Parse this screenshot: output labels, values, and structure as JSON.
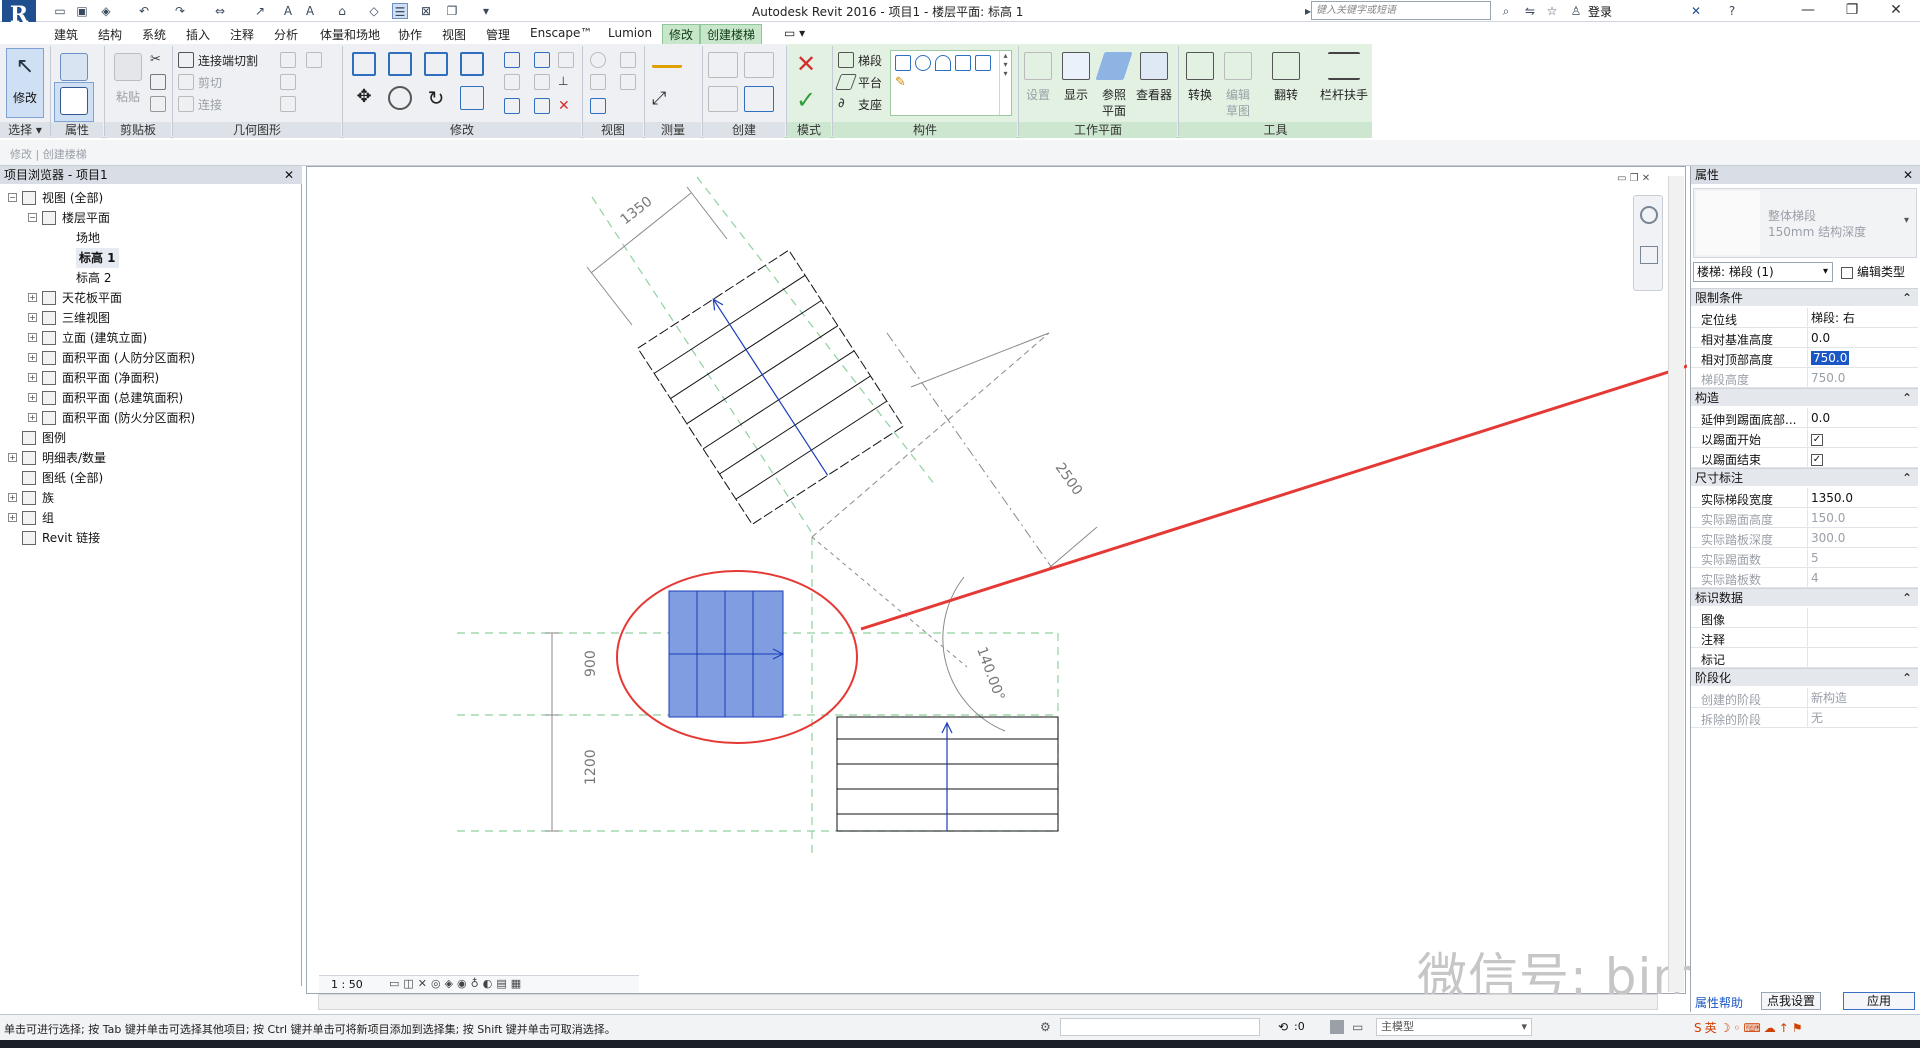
{
  "window": {
    "title": "Autodesk Revit 2016 -     项目1 - 楼层平面: 标高 1",
    "search_placeholder": "键入关键字或短语",
    "login": "登录",
    "minimize": "—",
    "restore": "❐",
    "close": "✕"
  },
  "ribbon_tabs": [
    "建筑",
    "结构",
    "系统",
    "插入",
    "注释",
    "分析",
    "体量和场地",
    "协作",
    "视图",
    "管理",
    "Enscape™",
    "Lumion",
    "修改",
    "创建楼梯"
  ],
  "ribbon": {
    "select_panel": {
      "label": "修改",
      "title": "选择 ▾"
    },
    "properties_panel": {
      "title": "属性"
    },
    "clipboard_panel": {
      "title": "剪贴板",
      "paste": "粘贴"
    },
    "geometry_panel": {
      "title": "几何图形",
      "join_cut": "连接端切割",
      "cut": "剪切",
      "join": "连接"
    },
    "modify_panel": {
      "title": "修改"
    },
    "view_panel": {
      "title": "视图"
    },
    "measure_panel": {
      "title": "测量"
    },
    "create_panel": {
      "title": "创建"
    },
    "mode_panel": {
      "title": "模式"
    },
    "components_panel": {
      "title": "构件",
      "run": "梯段",
      "landing": "平台",
      "support": "支座"
    },
    "workplane_panel": {
      "title": "工作平面",
      "set": "设置",
      "show": "显示",
      "ref_plane": "参照",
      "ref_plane2": "平面",
      "viewer": "查看器"
    },
    "tools_panel": {
      "title": "工具",
      "convert": "转换",
      "edit_sketch": "编辑",
      "edit_sketch2": "草图",
      "flip": "翻转",
      "railing": "栏杆扶手"
    }
  },
  "options_bar": {
    "text": "修改 | 创建楼梯"
  },
  "browser": {
    "title": "项目浏览器 - 项目1",
    "close": "✕",
    "items": [
      {
        "label": "视图 (全部)",
        "level": 0,
        "toggle": "−"
      },
      {
        "label": "楼层平面",
        "level": 1,
        "toggle": "−"
      },
      {
        "label": "场地",
        "level": 2,
        "toggle": ""
      },
      {
        "label": "标高 1",
        "level": 2,
        "toggle": "",
        "bold": true
      },
      {
        "label": "标高 2",
        "level": 2,
        "toggle": ""
      },
      {
        "label": "天花板平面",
        "level": 1,
        "toggle": "+"
      },
      {
        "label": "三维视图",
        "level": 1,
        "toggle": "+"
      },
      {
        "label": "立面 (建筑立面)",
        "level": 1,
        "toggle": "+"
      },
      {
        "label": "面积平面 (人防分区面积)",
        "level": 1,
        "toggle": "+"
      },
      {
        "label": "面积平面 (净面积)",
        "level": 1,
        "toggle": "+"
      },
      {
        "label": "面积平面 (总建筑面积)",
        "level": 1,
        "toggle": "+"
      },
      {
        "label": "面积平面 (防火分区面积)",
        "level": 1,
        "toggle": "+"
      },
      {
        "label": "图例",
        "level": 0,
        "toggle": ""
      },
      {
        "label": "明细表/数量",
        "level": 0,
        "toggle": "+"
      },
      {
        "label": "图纸 (全部)",
        "level": 0,
        "toggle": ""
      },
      {
        "label": "族",
        "level": 0,
        "toggle": "+"
      },
      {
        "label": "组",
        "level": 0,
        "toggle": "+"
      },
      {
        "label": "Revit 链接",
        "level": 0,
        "toggle": ""
      }
    ]
  },
  "canvas": {
    "dim_top": "1350",
    "dim_diag": "2500",
    "dim_angle": "140.00°",
    "dim_left1": "900",
    "dim_left2": "1200",
    "scale": "1 : 50",
    "watermark": "微信号: bimtech",
    "colors": {
      "selection": "#7f9de0",
      "highlight": "#e53935",
      "guide": "#8fd19e"
    }
  },
  "properties": {
    "title": "属性",
    "close": "✕",
    "type_name": "整体梯段",
    "type_desc": "150mm 结构深度",
    "selector": "楼梯: 梯段 (1)",
    "edit_type": "编辑类型",
    "sections": [
      {
        "title": "限制条件",
        "rows": [
          {
            "name": "定位线",
            "value": "梯段: 右"
          },
          {
            "name": "相对基准高度",
            "value": "0.0"
          },
          {
            "name": "相对顶部高度",
            "value": "750.0",
            "selected": true
          },
          {
            "name": "梯段高度",
            "value": "750.0",
            "dim": true
          }
        ]
      },
      {
        "title": "构造",
        "rows": [
          {
            "name": "延伸到踢面底部...",
            "value": "0.0"
          },
          {
            "name": "以踢面开始",
            "value": "✓",
            "check": true
          },
          {
            "name": "以踢面结束",
            "value": "✓",
            "check": true
          }
        ]
      },
      {
        "title": "尺寸标注",
        "rows": [
          {
            "name": "实际梯段宽度",
            "value": "1350.0"
          },
          {
            "name": "实际踢面高度",
            "value": "150.0",
            "dim": true
          },
          {
            "name": "实际踏板深度",
            "value": "300.0",
            "dim": true
          },
          {
            "name": "实际踢面数",
            "value": "5",
            "dim": true
          },
          {
            "name": "实际踏板数",
            "value": "4",
            "dim": true
          }
        ]
      },
      {
        "title": "标识数据",
        "rows": [
          {
            "name": "图像",
            "value": ""
          },
          {
            "name": "注释",
            "value": ""
          },
          {
            "name": "标记",
            "value": ""
          }
        ]
      },
      {
        "title": "阶段化",
        "rows": [
          {
            "name": "创建的阶段",
            "value": "新构造",
            "dim": true
          },
          {
            "name": "拆除的阶段",
            "value": "无",
            "dim": true
          }
        ]
      }
    ],
    "help_link": "属性帮助",
    "settings_link": "点我设置",
    "apply": "应用"
  },
  "status": {
    "text": "单击可进行选择; 按 Tab 键并单击可选择其他项目; 按 Ctrl 键并单击可将新项目添加到选择集; 按 Shift 键并单击可取消选择。",
    "zero": ":0",
    "model": "主模型"
  }
}
